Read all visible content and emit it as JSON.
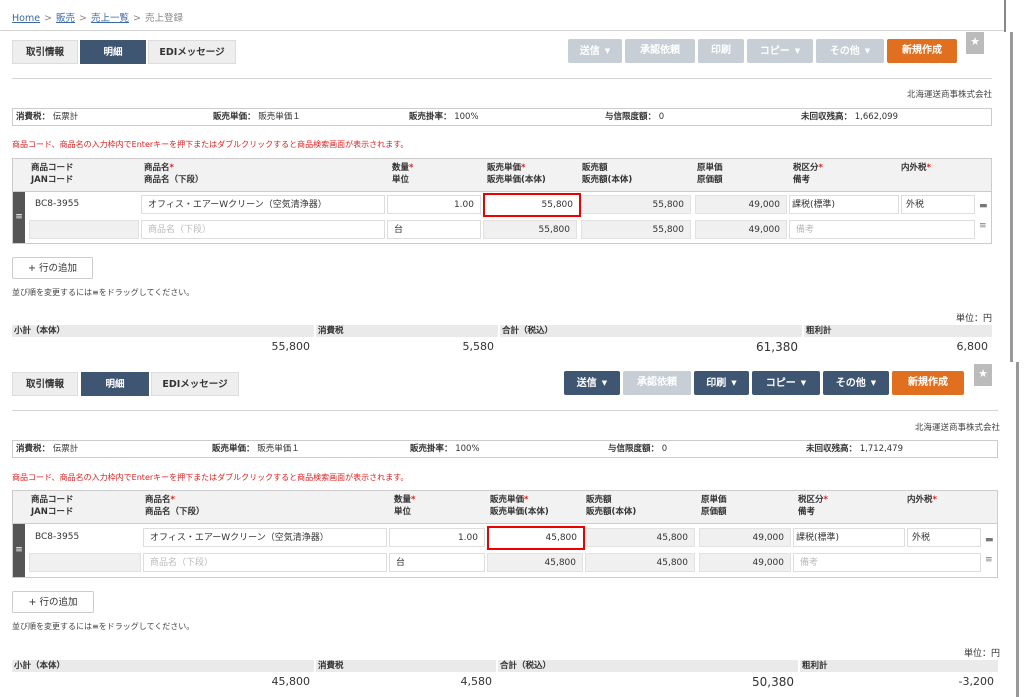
{
  "breadcrumb": {
    "home": "Home",
    "sales": "販売",
    "list": "売上一覧",
    "current": "売上登録",
    "sep": ">"
  },
  "tabs": {
    "info": "取引情報",
    "detail": "明細",
    "edi": "EDIメッセージ"
  },
  "actions": {
    "send": "送信",
    "approve": "承認依頼",
    "print": "印刷",
    "copy": "コピー",
    "other": "その他",
    "create": "新規作成",
    "star": "★"
  },
  "company": "北海運送商事株式会社",
  "labels": {
    "tax": "消費税：",
    "price_unit": "販売単価：",
    "rate": "販売掛率：",
    "credit": "与信限度額：",
    "unpaid": "未回収残高：",
    "notice": "商品コード、商品名の入力枠内でEnterキーを押下またはダブルクリックすると商品検索画面が表示されます。",
    "add_row": "+ 行の追加",
    "drag_hint": "並び順を変更するには≡をドラッグしてください。",
    "unit": "単位：円"
  },
  "grid_headers": {
    "code": "商品コード",
    "jan": "JANコード",
    "name": "商品名",
    "name_sub": "商品名（下段）",
    "qty": "数量",
    "uom": "単位",
    "price": "販売単価",
    "price_ex": "販売単価(本体)",
    "amount": "販売額",
    "amount_ex": "販売額(本体)",
    "cost": "原単価",
    "cost_amount": "原価額",
    "tax_class": "税区分",
    "memo": "備考",
    "tax_inout": "内外税",
    "req": "*"
  },
  "totals_headers": {
    "subtotal": "小計（本体）",
    "tax": "消費税",
    "total": "合計（税込）",
    "gross": "粗利計"
  },
  "icons": {
    "drag_handle": "≡",
    "note": "▬",
    "menu": "≡",
    "caret": "▼"
  },
  "panels": [
    {
      "info": {
        "tax": "伝票計",
        "price_unit": "販売単価１",
        "rate": "100%",
        "credit": "0",
        "unpaid": "1,662,099"
      },
      "row": {
        "code": "BC8-3955",
        "name": "オフィス・エアーWクリーン（空気清浄器）",
        "qty": "1.00",
        "uom": "台",
        "price": "55,800",
        "price_ex": "55,800",
        "amount": "55,800",
        "amount_ex": "55,800",
        "cost": "49,000",
        "cost_amount": "49,000",
        "tax_class": "課税(標準)",
        "tax_inout": "外税",
        "name_placeholder": "商品名（下段）",
        "memo_placeholder": "備考"
      },
      "totals": {
        "subtotal": "55,800",
        "tax": "5,580",
        "total": "61,380",
        "gross": "6,800"
      }
    },
    {
      "info": {
        "tax": "伝票計",
        "price_unit": "販売単価１",
        "rate": "100%",
        "credit": "0",
        "unpaid": "1,712,479"
      },
      "row": {
        "code": "BC8-3955",
        "name": "オフィス・エアーWクリーン（空気清浄器）",
        "qty": "1.00",
        "uom": "台",
        "price": "45,800",
        "price_ex": "45,800",
        "amount": "45,800",
        "amount_ex": "45,800",
        "cost": "49,000",
        "cost_amount": "49,000",
        "tax_class": "課税(標準)",
        "tax_inout": "外税",
        "name_placeholder": "商品名（下段）",
        "memo_placeholder": "備考"
      },
      "totals": {
        "subtotal": "45,800",
        "tax": "4,580",
        "total": "50,380",
        "gross": "-3,200"
      }
    }
  ]
}
